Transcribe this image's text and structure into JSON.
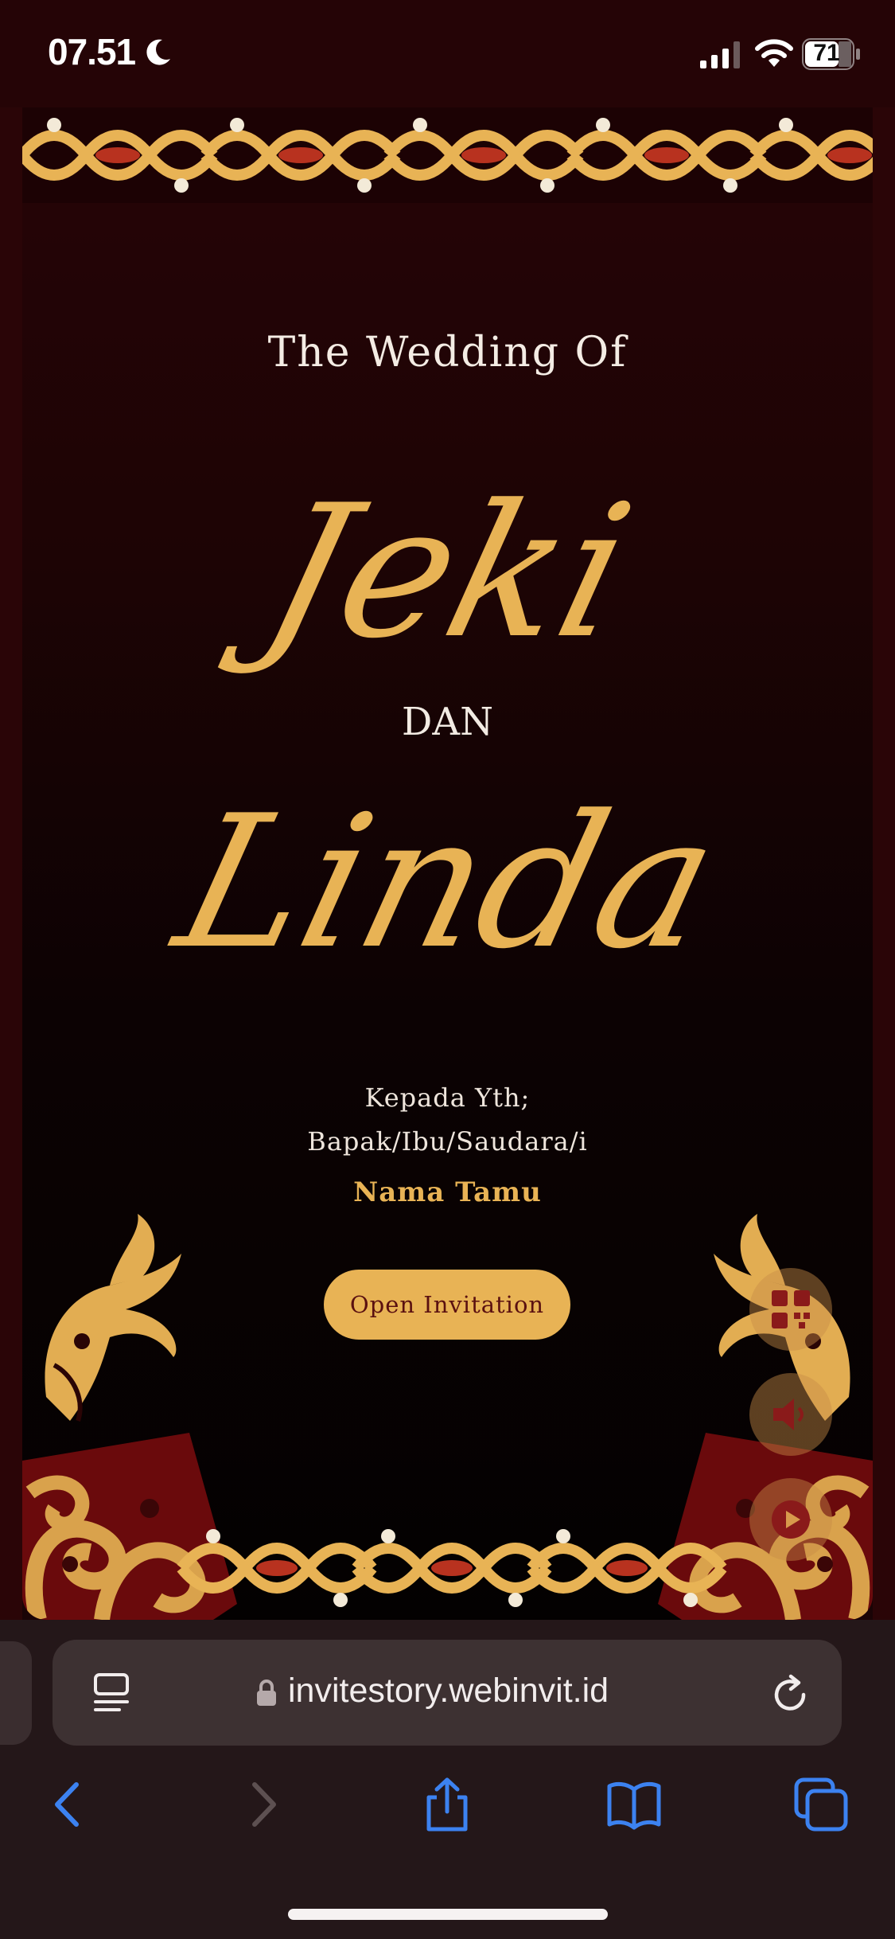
{
  "status_bar": {
    "time": "07.51",
    "battery": "71",
    "icons": [
      "moon-icon",
      "cellular-signal-icon",
      "wifi-icon",
      "battery-icon"
    ]
  },
  "invitation": {
    "intro_title": "The Wedding Of",
    "groom_name": "Jeki",
    "conjunction": "DAN",
    "bride_name": "Linda",
    "to_label": "Kepada Yth;",
    "to_group": "Bapak/Ibu/Saudara/i",
    "guest_name": "Nama Tamu",
    "open_button": "Open Invitation",
    "floating_buttons": [
      "qr-code-icon",
      "speaker-icon",
      "play-icon"
    ]
  },
  "browser": {
    "url": "invitestory.webinvit.id",
    "toolbar": [
      "back-icon",
      "forward-icon",
      "share-icon",
      "bookmarks-icon",
      "tabs-icon"
    ]
  },
  "colors": {
    "gold": "#e8b355",
    "maroon_bg": "#260406",
    "dark_bg": "#030101",
    "accent_blue": "#3c82f0"
  }
}
